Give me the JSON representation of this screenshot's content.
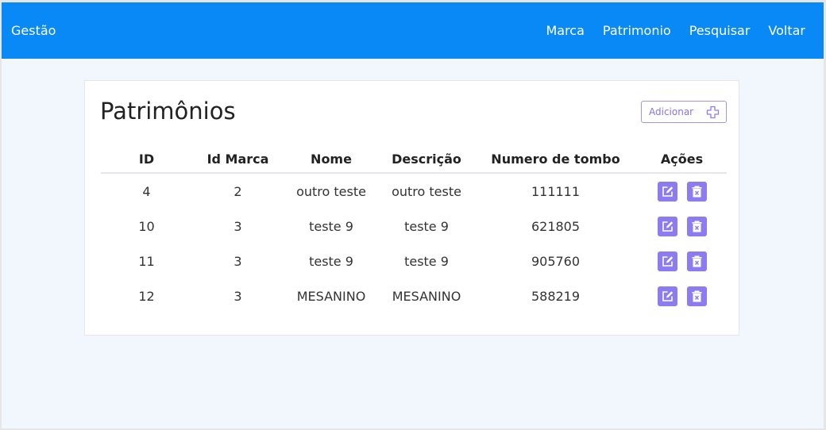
{
  "navbar": {
    "brand": "Gestão",
    "links": [
      "Marca",
      "Patrimonio",
      "Pesquisar",
      "Voltar"
    ]
  },
  "card": {
    "title": "Patrimônios",
    "add_button_label": "Adicionar",
    "add_icon": "plus-icon"
  },
  "table": {
    "columns": [
      "ID",
      "Id Marca",
      "Nome",
      "Descrição",
      "Numero de tombo",
      "Ações"
    ],
    "rows": [
      [
        "4",
        "2",
        "outro teste",
        "outro teste",
        "111111"
      ],
      [
        "10",
        "3",
        "teste 9",
        "teste 9",
        "621805"
      ],
      [
        "11",
        "3",
        "teste 9",
        "teste 9",
        "905760"
      ],
      [
        "12",
        "3",
        "MESANINO",
        "MESANINO",
        "588219"
      ]
    ],
    "row_actions": [
      "edit-icon",
      "delete-icon"
    ]
  },
  "colors": {
    "navbar": "#0989f5",
    "page_background": "#f2f7fd",
    "accent": "#8d7cef",
    "add_button_text": "#8474e6"
  }
}
